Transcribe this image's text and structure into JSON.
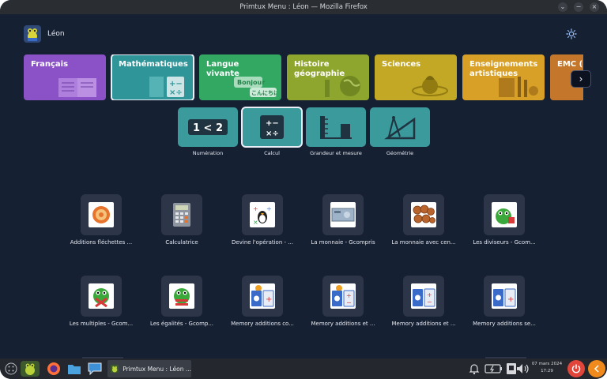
{
  "window": {
    "title": "Primtux Menu : Léon — Mozilla Firefox"
  },
  "user": {
    "name": "Léon"
  },
  "categories": [
    {
      "label": "Français",
      "color": "#8a52c6"
    },
    {
      "label": "Mathématiques",
      "color": "#2f9598"
    },
    {
      "label": "Langue vivante",
      "color": "#33a863"
    },
    {
      "label": "Histoire géographie",
      "color": "#8fa62e"
    },
    {
      "label": "Sciences",
      "color": "#c2a824"
    },
    {
      "label": "Enseignements artistiques",
      "color": "#d8a026"
    },
    {
      "label": "EMC (En mo",
      "color": "#c4772a"
    }
  ],
  "langue_art_text": {
    "hello": "Bonjour",
    "jp": "こんにちは"
  },
  "subcategories": [
    {
      "label": "Numération",
      "icon_text": "1 < 2"
    },
    {
      "label": "Calcul"
    },
    {
      "label": "Grandeur et mesure"
    },
    {
      "label": "Géométrie"
    }
  ],
  "activities": [
    {
      "label": "Additions fléchettes ..."
    },
    {
      "label": "Calculatrice"
    },
    {
      "label": "Devine l'opération - ..."
    },
    {
      "label": "La monnaie - Gcompris"
    },
    {
      "label": "La monnaie avec cen..."
    },
    {
      "label": "Les diviseurs - Gcom..."
    },
    {
      "label": "Les multiples - Gcom..."
    },
    {
      "label": "Les égalités - Gcomp..."
    },
    {
      "label": "Memory additions co..."
    },
    {
      "label": "Memory additions et ..."
    },
    {
      "label": "Memory additions et ..."
    },
    {
      "label": "Memory additions se..."
    }
  ],
  "taskbar": {
    "task_label": "Primtux Menu : Léon ...",
    "date": "07 mars 2024",
    "time": "17:29"
  }
}
